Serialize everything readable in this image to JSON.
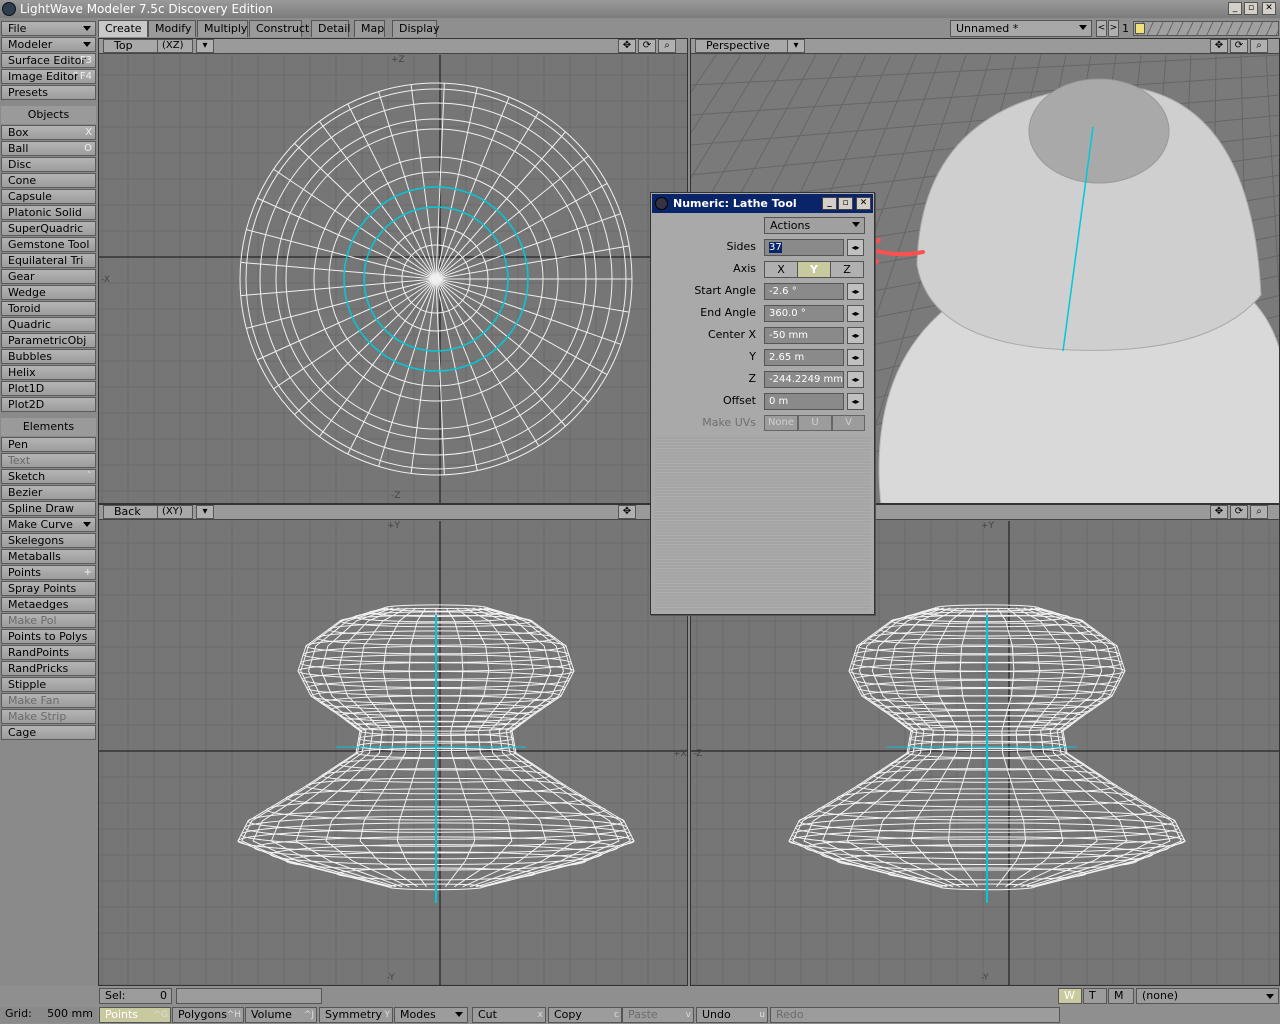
{
  "window": {
    "title": "LightWave Modeler 7.5c Discovery Edition"
  },
  "tabs": [
    {
      "label": "Create",
      "active": true
    },
    {
      "label": "Modify"
    },
    {
      "label": "Multiply"
    },
    {
      "label": "Construct"
    },
    {
      "label": "Detail"
    },
    {
      "label": "Map"
    },
    {
      "label": "Display"
    }
  ],
  "object_select": {
    "value": "Unnamed *",
    "layer": "1"
  },
  "left_top": [
    {
      "label": "File",
      "dropdown": true
    },
    {
      "label": "Modeler",
      "dropdown": true
    },
    {
      "label": "Surface Editor",
      "shortcut": "F3"
    },
    {
      "label": "Image Editor",
      "shortcut": "^F4"
    },
    {
      "label": "Presets"
    }
  ],
  "objects_header": "Objects",
  "objects": [
    {
      "label": "Box",
      "shortcut": "X"
    },
    {
      "label": "Ball",
      "shortcut": "O"
    },
    {
      "label": "Disc"
    },
    {
      "label": "Cone"
    },
    {
      "label": "Capsule"
    },
    {
      "label": "Platonic Solid"
    },
    {
      "label": "SuperQuadric"
    },
    {
      "label": "Gemstone Tool"
    },
    {
      "label": "Equilateral Tri"
    },
    {
      "label": "Gear"
    },
    {
      "label": "Wedge"
    },
    {
      "label": "Toroid"
    },
    {
      "label": "Quadric"
    },
    {
      "label": "ParametricObj"
    },
    {
      "label": "Bubbles"
    },
    {
      "label": "Helix"
    },
    {
      "label": "Plot1D"
    },
    {
      "label": "Plot2D"
    }
  ],
  "elements_header": "Elements",
  "elements": [
    {
      "label": "Pen"
    },
    {
      "label": "Text",
      "disabled": true
    },
    {
      "label": "Sketch",
      "shortcut": "`"
    },
    {
      "label": "Bezier"
    },
    {
      "label": "Spline Draw"
    },
    {
      "label": "Make Curve",
      "dropdown": true
    },
    {
      "label": "Skelegons"
    },
    {
      "label": "Metaballs"
    },
    {
      "label": "Points",
      "shortcut": "+"
    },
    {
      "label": "Spray Points"
    },
    {
      "label": "Metaedges"
    },
    {
      "label": "Make Pol",
      "disabled": true
    },
    {
      "label": "Points to Polys"
    },
    {
      "label": "RandPoints"
    },
    {
      "label": "RandPricks"
    },
    {
      "label": "Stipple"
    },
    {
      "label": "Make Fan",
      "disabled": true
    },
    {
      "label": "Make Strip",
      "disabled": true
    },
    {
      "label": "Cage"
    }
  ],
  "viewports": {
    "top": {
      "label": "Top",
      "view": "(XZ)"
    },
    "perspective": {
      "label": "Perspective"
    },
    "back": {
      "label": "Back",
      "view": "(XY)"
    },
    "axis_labels": {
      "top_n": "+Z",
      "top_s": "-Z",
      "top_w": "-X",
      "back_n": "+Y",
      "back_s": "-Y",
      "back_e": "+X",
      "right_n": "+Y",
      "right_s": "-Y",
      "right_w": "-Z"
    }
  },
  "numeric": {
    "title": "Numeric: Lathe Tool",
    "actions": "Actions",
    "sides_label": "Sides",
    "sides": "37",
    "axis_label": "Axis",
    "axis_options": [
      "X",
      "Y",
      "Z"
    ],
    "axis_selected": "Y",
    "start_label": "Start Angle",
    "start": "-2.6 °",
    "end_label": "End Angle",
    "end": "360.0 °",
    "cx_label": "Center X",
    "cx": "-50 mm",
    "cy_label": "Y",
    "cy": "2.65 m",
    "cz_label": "Z",
    "cz": "-244.2249 mm",
    "offset_label": "Offset",
    "offset": "0 m",
    "uv_label": "Make UVs",
    "uv_options": [
      "None",
      "U",
      "V"
    ]
  },
  "status": {
    "sel_label": "Sel:",
    "sel_value": "0",
    "grid_label": "Grid:",
    "grid_value": "500 mm",
    "wtm": [
      "W",
      "T",
      "M"
    ],
    "surface": "(none)",
    "modes": [
      {
        "label": "Points",
        "key": "^G",
        "active": true
      },
      {
        "label": "Polygons",
        "key": "^H"
      },
      {
        "label": "Volume",
        "key": "^J"
      },
      {
        "label": "Symmetry",
        "key": "Y"
      },
      {
        "label": "Modes",
        "dropdown": true
      },
      {
        "label": "Cut",
        "key": "x"
      },
      {
        "label": "Copy",
        "key": "c"
      },
      {
        "label": "Paste",
        "key": "v",
        "disabled": true
      },
      {
        "label": "Undo",
        "key": "u"
      },
      {
        "label": "Redo",
        "disabled": true
      }
    ]
  },
  "colors": {
    "accent": "#00c8d8",
    "annotation_arrow": "#ff5050",
    "titlebar": "#0a246a"
  }
}
